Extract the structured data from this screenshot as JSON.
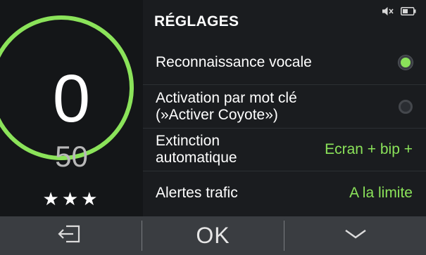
{
  "speed": {
    "current": "0",
    "limit": "50",
    "rating": "★★★",
    "ring_color": "#8be35a"
  },
  "status": {
    "icons": [
      "sound-muted-icon",
      "battery-icon"
    ]
  },
  "settings": {
    "title": "RÉGLAGES",
    "items": [
      {
        "label": "Reconnaissance vocale",
        "control": "radio",
        "checked": true
      },
      {
        "label_line1": "Activation par mot clé",
        "label_line2": "(»Activer Coyote»)",
        "control": "radio",
        "checked": false
      },
      {
        "label_line1": "Extinction",
        "label_line2": "automatique",
        "value": "Ecran + bip +"
      },
      {
        "label": "Alertes trafic",
        "value": "A la limite"
      }
    ]
  },
  "bottom_bar": {
    "back_icon": "exit-icon",
    "ok_label": "OK",
    "down_icon": "chevron-down-icon"
  },
  "colors": {
    "accent": "#8be35a",
    "background": "#111315",
    "panel": "#1a1c1f",
    "bar": "#3a3d41"
  }
}
